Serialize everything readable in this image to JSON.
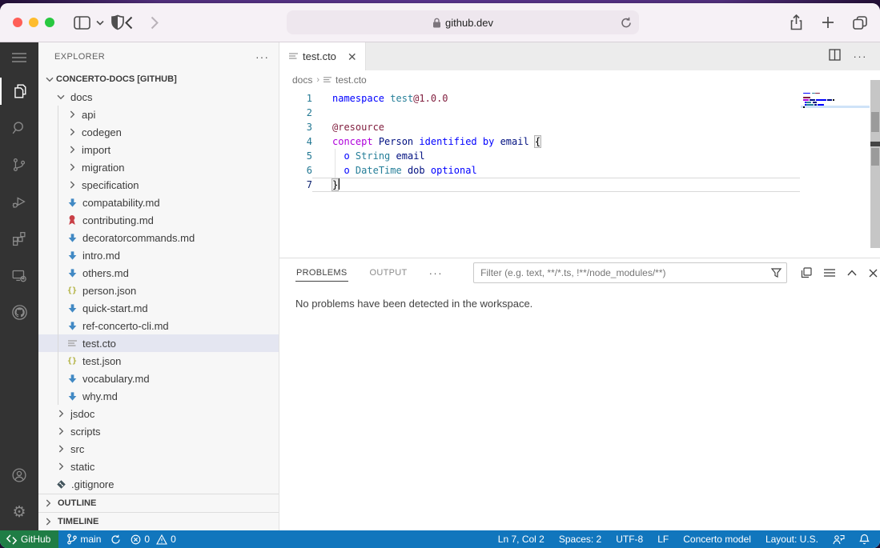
{
  "browser": {
    "url": "github.dev",
    "controls": [
      "close",
      "minimize",
      "zoom",
      "sidebar-toggle",
      "back",
      "forward",
      "privacy-shield",
      "reload",
      "share",
      "new-tab",
      "tab-overview"
    ]
  },
  "vscode": {
    "activity_bar": {
      "items": [
        {
          "name": "menu"
        },
        {
          "name": "explorer",
          "active": true
        },
        {
          "name": "search"
        },
        {
          "name": "source-control"
        },
        {
          "name": "run-debug"
        },
        {
          "name": "extensions"
        },
        {
          "name": "remote-explorer"
        },
        {
          "name": "github"
        }
      ],
      "bottom": [
        {
          "name": "account"
        },
        {
          "name": "settings"
        }
      ]
    },
    "explorer": {
      "title": "EXPLORER",
      "root": {
        "label": "CONCERTO-DOCS [GITHUB]",
        "expanded": true
      },
      "items": [
        {
          "label": "docs",
          "level": 1,
          "icon": "chevron-down"
        },
        {
          "label": "api",
          "level": 2,
          "icon": "chevron-right"
        },
        {
          "label": "codegen",
          "level": 2,
          "icon": "chevron-right"
        },
        {
          "label": "import",
          "level": 2,
          "icon": "chevron-right"
        },
        {
          "label": "migration",
          "level": 2,
          "icon": "chevron-right"
        },
        {
          "label": "specification",
          "level": 2,
          "icon": "chevron-right"
        },
        {
          "label": "compatability.md",
          "level": 2,
          "icon": "markdown"
        },
        {
          "label": "contributing.md",
          "level": 2,
          "icon": "ribbon"
        },
        {
          "label": "decoratorcommands.md",
          "level": 2,
          "icon": "markdown"
        },
        {
          "label": "intro.md",
          "level": 2,
          "icon": "markdown"
        },
        {
          "label": "others.md",
          "level": 2,
          "icon": "markdown"
        },
        {
          "label": "person.json",
          "level": 2,
          "icon": "json"
        },
        {
          "label": "quick-start.md",
          "level": 2,
          "icon": "markdown"
        },
        {
          "label": "ref-concerto-cli.md",
          "level": 2,
          "icon": "markdown"
        },
        {
          "label": "test.cto",
          "level": 2,
          "icon": "text",
          "selected": true
        },
        {
          "label": "test.json",
          "level": 2,
          "icon": "json"
        },
        {
          "label": "vocabulary.md",
          "level": 2,
          "icon": "markdown"
        },
        {
          "label": "why.md",
          "level": 2,
          "icon": "markdown"
        },
        {
          "label": "jsdoc",
          "level": 1,
          "icon": "chevron-right"
        },
        {
          "label": "scripts",
          "level": 1,
          "icon": "chevron-right"
        },
        {
          "label": "src",
          "level": 1,
          "icon": "chevron-right"
        },
        {
          "label": "static",
          "level": 1,
          "icon": "chevron-right"
        },
        {
          "label": ".gitignore",
          "level": 1,
          "icon": "git"
        }
      ],
      "sections": [
        {
          "label": "OUTLINE"
        },
        {
          "label": "TIMELINE"
        }
      ]
    },
    "editor": {
      "tab": {
        "label": "test.cto"
      },
      "breadcrumbs": [
        "docs",
        "test.cto"
      ],
      "token_colors": {
        "kw": "#0000FF",
        "ty": "#267F99",
        "id": "#001080",
        "dc": "#811F3F",
        "ctl": "#AF00DB",
        "pl": "#000000"
      },
      "lines": [
        {
          "num": "1",
          "tokens": [
            [
              "namespace",
              "kw"
            ],
            [
              " ",
              "pl"
            ],
            [
              "test",
              "ty"
            ],
            [
              "@1.0.0",
              "dc"
            ]
          ]
        },
        {
          "num": "2",
          "tokens": []
        },
        {
          "num": "3",
          "tokens": [
            [
              "@resource",
              "dc"
            ]
          ]
        },
        {
          "num": "4",
          "tokens": [
            [
              "concept",
              "ctl"
            ],
            [
              " ",
              "pl"
            ],
            [
              "Person",
              "id"
            ],
            [
              " ",
              "pl"
            ],
            [
              "identified by",
              "kw"
            ],
            [
              " ",
              "pl"
            ],
            [
              "email",
              "id"
            ],
            [
              " ",
              "pl"
            ],
            [
              "{",
              "pl",
              "brk"
            ]
          ]
        },
        {
          "num": "5",
          "guide": true,
          "tokens": [
            [
              "  ",
              "pl"
            ],
            [
              "o",
              "kw"
            ],
            [
              " ",
              "pl"
            ],
            [
              "String",
              "ty"
            ],
            [
              " ",
              "pl"
            ],
            [
              "email",
              "id"
            ]
          ]
        },
        {
          "num": "6",
          "guide": true,
          "tokens": [
            [
              "  ",
              "pl"
            ],
            [
              "o",
              "kw"
            ],
            [
              " ",
              "pl"
            ],
            [
              "DateTime",
              "ty"
            ],
            [
              " ",
              "pl"
            ],
            [
              "dob",
              "id"
            ],
            [
              " ",
              "pl"
            ],
            [
              "optional",
              "kw"
            ]
          ]
        },
        {
          "num": "7",
          "current": true,
          "cursor": true,
          "tokens": [
            [
              "}",
              "pl",
              "brk"
            ]
          ]
        }
      ]
    },
    "panel": {
      "tabs": [
        {
          "label": "PROBLEMS",
          "active": true
        },
        {
          "label": "OUTPUT",
          "active": false
        }
      ],
      "more_label": "···",
      "filter_placeholder": "Filter (e.g. text, **/*.ts, !**/node_modules/**)",
      "message": "No problems have been detected in the workspace."
    },
    "status_bar": {
      "remote_label": "GitHub",
      "branch": "main",
      "errors": "0",
      "warnings": "0",
      "right_items": [
        "Ln 7, Col 2",
        "Spaces: 2",
        "UTF-8",
        "LF",
        "Concerto model",
        "Layout: U.S."
      ],
      "colors": {
        "remote_bg": "#1f7d45",
        "bar_bg": "#1176bd"
      }
    }
  }
}
